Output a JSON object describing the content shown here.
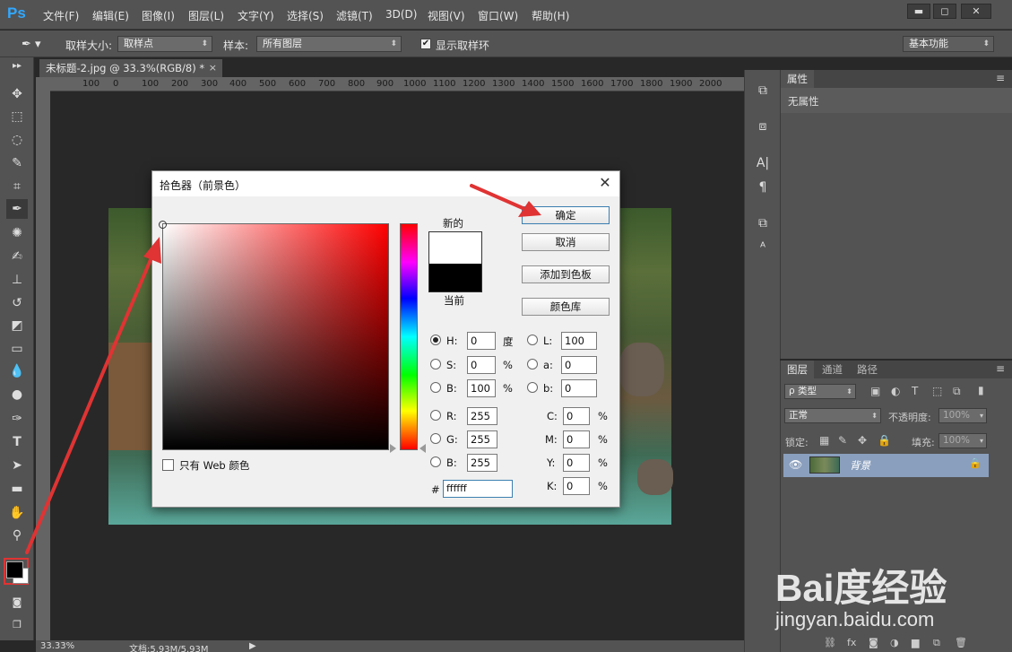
{
  "app": {
    "logo": "Ps",
    "menu": [
      "文件(F)",
      "编辑(E)",
      "图像(I)",
      "图层(L)",
      "文字(Y)",
      "选择(S)",
      "滤镜(T)",
      "3D(D)",
      "视图(V)",
      "窗口(W)",
      "帮助(H)"
    ],
    "window_buttons": [
      "▬",
      "◻",
      "✕"
    ]
  },
  "options_bar": {
    "sample_size_label": "取样大小:",
    "sample_size_value": "取样点",
    "sample_label": "样本:",
    "sample_value": "所有图层",
    "show_ring_label": "显示取样环",
    "show_ring_checked": true,
    "workspace": "基本功能"
  },
  "document": {
    "tab_title": "未标题-2.jpg @ 33.3%(RGB/8) *",
    "tab_close": "×",
    "ruler_labels": [
      "100",
      "0",
      "100",
      "200",
      "300",
      "400",
      "500",
      "600",
      "700",
      "800",
      "900",
      "1000",
      "1100",
      "1200",
      "1300",
      "1400",
      "1500",
      "1600",
      "1700",
      "1800",
      "1900",
      "2000"
    ],
    "zoom": "33.33%",
    "doc_size": "文档:5.93M/5.93M"
  },
  "tools": [
    "move-tool",
    "marquee-tool",
    "lasso-tool",
    "quick-select-tool",
    "crop-tool",
    "eyedropper-tool",
    "healing-brush-tool",
    "brush-tool",
    "clone-stamp-tool",
    "history-brush-tool",
    "eraser-tool",
    "gradient-tool",
    "blur-tool",
    "dodge-tool",
    "pen-tool",
    "type-tool",
    "path-select-tool",
    "shape-tool",
    "hand-tool",
    "zoom-tool"
  ],
  "properties_panel": {
    "tab": "属性",
    "empty_text": "无属性"
  },
  "layers_panel": {
    "tabs": [
      "图层",
      "通道",
      "路径"
    ],
    "filter_kind": "ρ 类型",
    "blend_mode": "正常",
    "opacity_label": "不透明度:",
    "opacity_value": "100%",
    "lock_label": "锁定:",
    "fill_label": "填充:",
    "fill_value": "100%",
    "layer_name": "背景"
  },
  "color_picker": {
    "title": "拾色器（前景色）",
    "new_label": "新的",
    "current_label": "当前",
    "new_color": "#ffffff",
    "current_color": "#000000",
    "ok_button": "确定",
    "cancel_button": "取消",
    "add_swatch_button": "添加到色板",
    "color_library_button": "颜色库",
    "web_only_label": "只有 Web 颜色",
    "hsb": {
      "H_label": "H:",
      "H": "0",
      "H_unit": "度",
      "S_label": "S:",
      "S": "0",
      "S_unit": "%",
      "B_label": "B:",
      "B": "100",
      "B_unit": "%"
    },
    "lab": {
      "L_label": "L:",
      "L": "100",
      "a_label": "a:",
      "a": "0",
      "b_label": "b:",
      "b": "0"
    },
    "rgb": {
      "R_label": "R:",
      "R": "255",
      "G_label": "G:",
      "G": "255",
      "B_label": "B:",
      "B": "255"
    },
    "cmyk": {
      "C_label": "C:",
      "C": "0",
      "C_unit": "%",
      "M_label": "M:",
      "M": "0",
      "M_unit": "%",
      "Y_label": "Y:",
      "Y": "0",
      "Y_unit": "%",
      "K_label": "K:",
      "K": "0",
      "K_unit": "%"
    },
    "hex_label": "#",
    "hex": "ffffff"
  },
  "watermark": {
    "logo": "Bai度经验",
    "url": "jingyan.baidu.com"
  },
  "colors": {
    "annotation_red": "#e03333",
    "panel_gray": "#535353",
    "layer_selected": "#8a9fbd"
  }
}
